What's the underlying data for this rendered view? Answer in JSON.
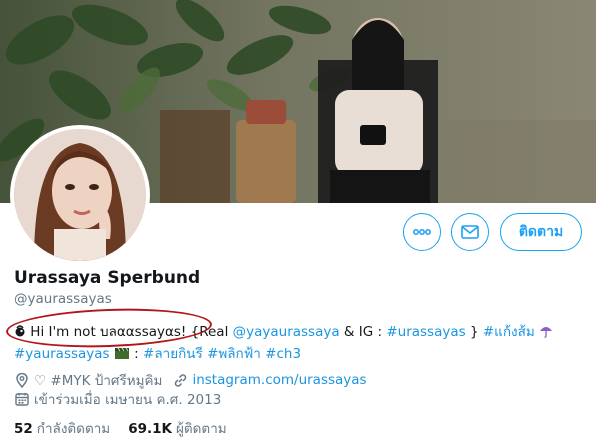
{
  "profile": {
    "name": "Urassaya Sperbund",
    "handle": "@yaurassayas"
  },
  "actions": {
    "follow_label": "ติดตาม",
    "more_icon": "more-dots-icon",
    "message_icon": "envelope-icon"
  },
  "bio": {
    "line1_prefix": "Hi I'm not บลααssayαs! {Real ",
    "mention": "@yayaurassaya",
    "line1_mid": " & IG : ",
    "hashtag_ig": "#urassayas",
    "line1_mid2": " } ",
    "hashtag_kaengsom": "#แก้งส้ม",
    "line2_hashtag1": "#yaurassayas",
    "line2_sep": " : ",
    "line2_hashtag2": "#ลายกินรี",
    "line2_hashtag3": "#พลิกฟ้า",
    "line2_hashtag4": "#ch3"
  },
  "meta": {
    "location": "♡ #MYK ป้าศรีหมูคิม",
    "website": "instagram.com/urassayas",
    "joined": "เข้าร่วมเมื่อ เมษายน ค.ศ. 2013"
  },
  "counts": {
    "following_value": "52",
    "following_label": "กำลังติดตาม",
    "followers_value": "69.1K",
    "followers_label": "ผู้ติดตาม"
  },
  "colors": {
    "accent": "#1da1f2",
    "link": "#1b95e0",
    "muted": "#657786",
    "annotation": "#b0161a"
  }
}
